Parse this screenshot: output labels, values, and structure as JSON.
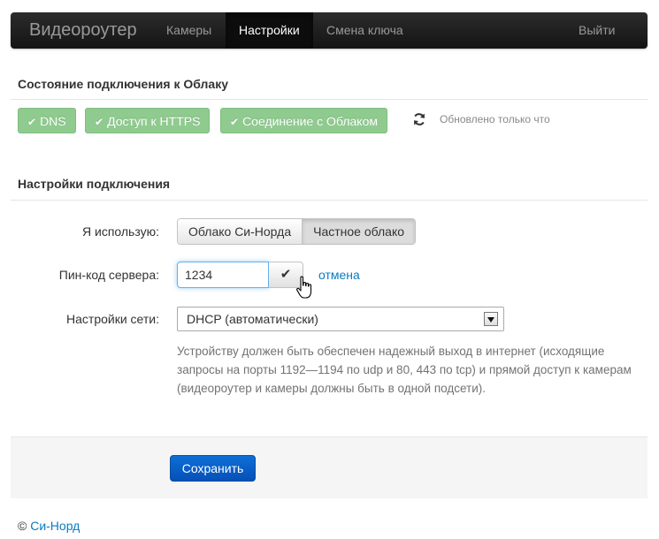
{
  "navbar": {
    "brand": "Видеороутер",
    "items": [
      {
        "label": "Камеры",
        "active": false
      },
      {
        "label": "Настройки",
        "active": true
      },
      {
        "label": "Смена ключа",
        "active": false
      }
    ],
    "logout": "Выйти"
  },
  "cloud_status": {
    "title": "Состояние подключения к Облаку",
    "pills": [
      {
        "label": "DNS",
        "state": "ok"
      },
      {
        "label": "Доступ к HTTPS",
        "state": "ok"
      },
      {
        "label": "Соединение с Облаком",
        "state": "ok"
      }
    ],
    "updated_text": "Обновлено только что",
    "refresh_icon": "refresh-icon"
  },
  "connection_settings": {
    "title": "Настройки подключения",
    "use_label": "Я использую:",
    "use_options": [
      {
        "label": "Облако Си-Норда",
        "selected": false
      },
      {
        "label": "Частное облако",
        "selected": true
      }
    ],
    "pin_label": "Пин-код сервера:",
    "pin_value": "1234",
    "pin_confirm_icon": "check-icon",
    "cancel_label": "отмена",
    "network_label": "Настройки сети:",
    "network_selected": "DHCP (автоматически)",
    "help_text": "Устройству должен быть обеспечен надежный выход в интернет (исходящие запросы на порты 1192—1194 по udp и 80, 443 по tcp) и прямой доступ к камерам (видеороутер и камеры должны быть в одной подсети)."
  },
  "actions": {
    "save_label": "Сохранить"
  },
  "footer": {
    "copyright_symbol": "©",
    "company": "Си-Норд"
  },
  "colors": {
    "navbar": "#1b1b1b",
    "status_ok": "#8fcb8f",
    "primary": "#0650b8",
    "link": "#0a7bc1"
  }
}
